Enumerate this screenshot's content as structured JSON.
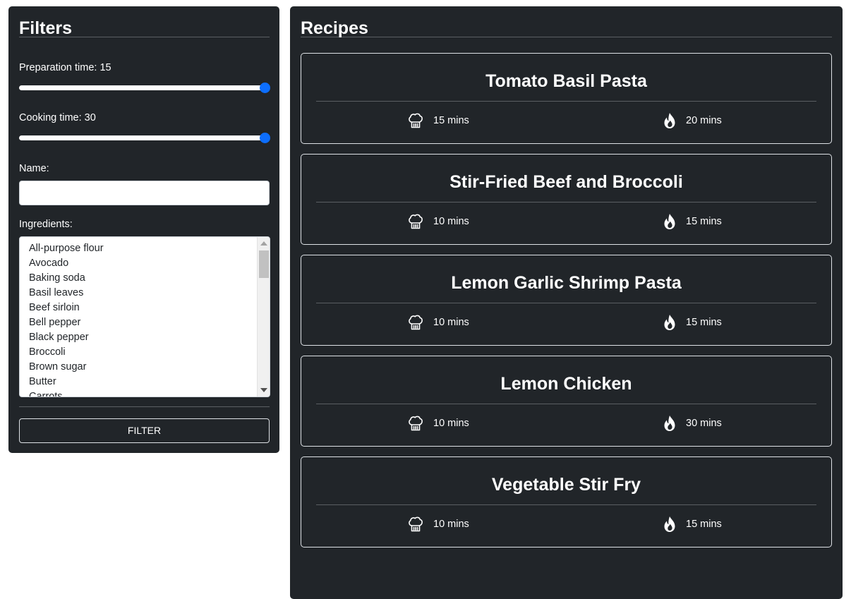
{
  "filters": {
    "title": "Filters",
    "prep_label": "Preparation time: 15",
    "prep_value": 15,
    "cook_label": "Cooking time: 30",
    "cook_value": 30,
    "name_label": "Name:",
    "name_value": "",
    "ingredients_label": "Ingredients:",
    "ingredients": [
      "All-purpose flour",
      "Avocado",
      "Baking soda",
      "Basil leaves",
      "Beef sirloin",
      "Bell pepper",
      "Black pepper",
      "Broccoli",
      "Brown sugar",
      "Butter",
      "Carrots"
    ],
    "filter_button": "FILTER"
  },
  "recipes": {
    "title": "Recipes",
    "items": [
      {
        "name": "Tomato Basil Pasta",
        "prep": "15 mins",
        "cook": "20 mins"
      },
      {
        "name": "Stir-Fried Beef and Broccoli",
        "prep": "10 mins",
        "cook": "15 mins"
      },
      {
        "name": "Lemon Garlic Shrimp Pasta",
        "prep": "10 mins",
        "cook": "15 mins"
      },
      {
        "name": "Lemon Chicken",
        "prep": "10 mins",
        "cook": "30 mins"
      },
      {
        "name": "Vegetable Stir Fry",
        "prep": "10 mins",
        "cook": "15 mins"
      }
    ]
  },
  "icons": {
    "prep": "chef-hat-icon",
    "cook": "fire-icon"
  },
  "colors": {
    "panel": "#212529",
    "accent": "#0d6efd",
    "border": "#dee2e6"
  }
}
